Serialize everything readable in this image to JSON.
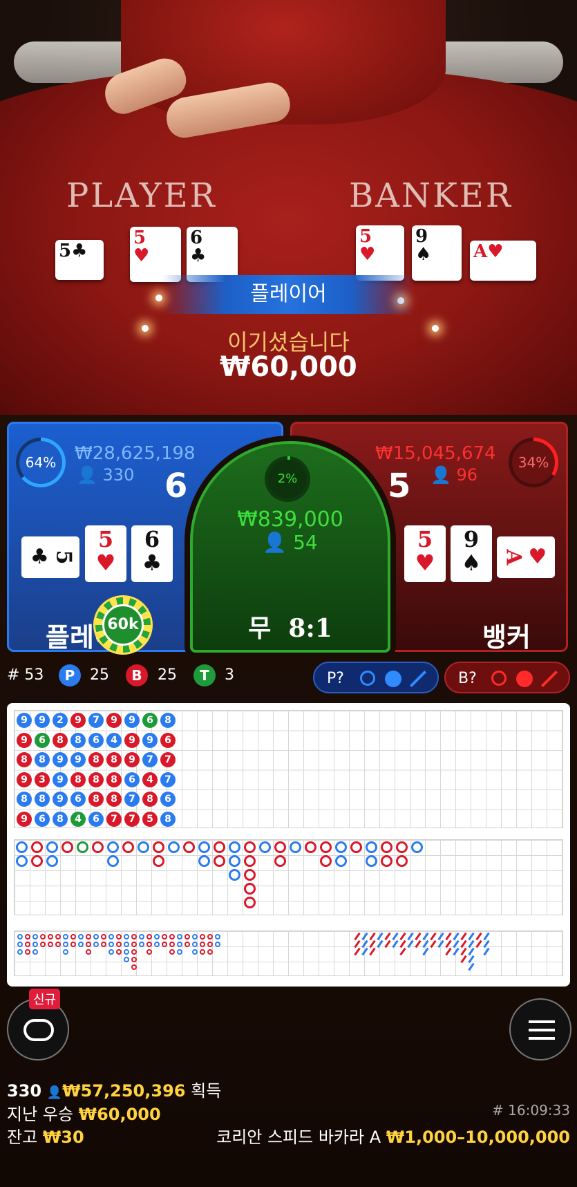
{
  "table": {
    "player_label": "PLAYER",
    "banker_label": "BANKER",
    "player_cards": [
      {
        "rank": "5",
        "suit": "♣",
        "color": "black"
      },
      {
        "rank": "5",
        "suit": "♥",
        "color": "red"
      },
      {
        "rank": "6",
        "suit": "♣",
        "color": "black"
      }
    ],
    "banker_cards": [
      {
        "rank": "5",
        "suit": "♥",
        "color": "red"
      },
      {
        "rank": "9",
        "suit": "♠",
        "color": "black"
      },
      {
        "rank": "A",
        "suit": "♥",
        "color": "red"
      }
    ]
  },
  "result": {
    "winner": "플레이어",
    "message": "이기셨습니다",
    "amount": "₩60,000"
  },
  "player": {
    "percent": "64%",
    "percent_value": 64,
    "total": "₩28,625,198",
    "count": "330",
    "score": "6",
    "label": "플레이어",
    "chip": "60k",
    "cards": [
      {
        "rank": "5",
        "suit": "♣",
        "color": "black",
        "rotated": true
      },
      {
        "rank": "5",
        "suit": "♥",
        "color": "red"
      },
      {
        "rank": "6",
        "suit": "♣",
        "color": "black"
      }
    ]
  },
  "tie": {
    "percent": "2%",
    "percent_value": 2,
    "total": "₩839,000",
    "count": "54",
    "label": "무",
    "payout": "8:1"
  },
  "banker": {
    "percent": "34%",
    "percent_value": 34,
    "total": "₩15,045,674",
    "count": "96",
    "score": "5",
    "label": "뱅커",
    "cards": [
      {
        "rank": "5",
        "suit": "♥",
        "color": "red"
      },
      {
        "rank": "9",
        "suit": "♠",
        "color": "black"
      },
      {
        "rank": "A",
        "suit": "♥",
        "color": "red",
        "rotated": true
      }
    ]
  },
  "stats": {
    "round_label": "# 53",
    "p_letter": "P",
    "p_count": "25",
    "b_letter": "B",
    "b_count": "25",
    "t_letter": "T",
    "t_count": "3",
    "p_predict": "P?",
    "b_predict": "B?"
  },
  "bead_road": [
    [
      [
        "9",
        "b"
      ],
      [
        "9",
        "r"
      ],
      [
        "8",
        "r"
      ],
      [
        "9",
        "r"
      ],
      [
        "8",
        "b"
      ],
      [
        "9",
        "r"
      ]
    ],
    [
      [
        "9",
        "b"
      ],
      [
        "6",
        "g"
      ],
      [
        "8",
        "b"
      ],
      [
        "3",
        "r"
      ],
      [
        "8",
        "b"
      ],
      [
        "6",
        "b"
      ]
    ],
    [
      [
        "2",
        "b"
      ],
      [
        "8",
        "r"
      ],
      [
        "9",
        "b"
      ],
      [
        "9",
        "b"
      ],
      [
        "9",
        "b"
      ],
      [
        "8",
        "b"
      ]
    ],
    [
      [
        "9",
        "r"
      ],
      [
        "8",
        "b"
      ],
      [
        "9",
        "b"
      ],
      [
        "8",
        "r"
      ],
      [
        "6",
        "b"
      ],
      [
        "4",
        "g"
      ]
    ],
    [
      [
        "7",
        "b"
      ],
      [
        "6",
        "b"
      ],
      [
        "8",
        "r"
      ],
      [
        "8",
        "r"
      ],
      [
        "8",
        "r"
      ],
      [
        "6",
        "b"
      ]
    ],
    [
      [
        "9",
        "r"
      ],
      [
        "4",
        "b"
      ],
      [
        "8",
        "r"
      ],
      [
        "8",
        "r"
      ],
      [
        "8",
        "r"
      ],
      [
        "7",
        "r"
      ]
    ],
    [
      [
        "9",
        "b"
      ],
      [
        "9",
        "r"
      ],
      [
        "9",
        "r"
      ],
      [
        "6",
        "b"
      ],
      [
        "7",
        "b"
      ],
      [
        "7",
        "r"
      ]
    ],
    [
      [
        "6",
        "g"
      ],
      [
        "9",
        "b"
      ],
      [
        "7",
        "b"
      ],
      [
        "4",
        "r"
      ],
      [
        "8",
        "r"
      ],
      [
        "5",
        "r"
      ]
    ],
    [
      [
        "8",
        "b"
      ],
      [
        "6",
        "r"
      ],
      [
        "7",
        "r"
      ],
      [
        "7",
        "b"
      ],
      [
        "6",
        "b"
      ],
      [
        "8",
        "b"
      ]
    ]
  ],
  "big_road": [
    [
      "b",
      2
    ],
    [
      "r",
      2
    ],
    [
      "b",
      2
    ],
    [
      "r",
      1
    ],
    [
      "g",
      1
    ],
    [
      "r",
      1
    ],
    [
      "b",
      2
    ],
    [
      "r",
      1
    ],
    [
      "b",
      1
    ],
    [
      "r",
      2
    ],
    [
      "b",
      1
    ],
    [
      "r",
      1
    ],
    [
      "b",
      2
    ],
    [
      "r",
      2
    ],
    [
      "b",
      3
    ],
    [
      "r",
      5
    ],
    [
      "b",
      1
    ],
    [
      "r",
      2
    ],
    [
      "b",
      1
    ],
    [
      "r",
      1
    ],
    [
      "r",
      2
    ],
    [
      "b",
      2
    ],
    [
      "r",
      1
    ],
    [
      "b",
      2
    ],
    [
      "r",
      2
    ],
    [
      "r",
      2
    ],
    [
      "b",
      1
    ]
  ],
  "bottom": {
    "new_badge": "신규",
    "players": "330",
    "total_win": "₩57,250,396",
    "win_label": "획득",
    "last_win_label": "지난 우승",
    "last_win": "₩60,000",
    "balance_label": "잔고",
    "balance": "₩30",
    "time": "# 16:09:33",
    "table_name": "코리안 스피드 바카라 A",
    "limits": "₩1,000–10,000,000"
  },
  "colors": {
    "player": "#2b7bf0",
    "banker": "#d9182a",
    "tie": "#1f9a3a",
    "gold": "#ffd23f"
  }
}
